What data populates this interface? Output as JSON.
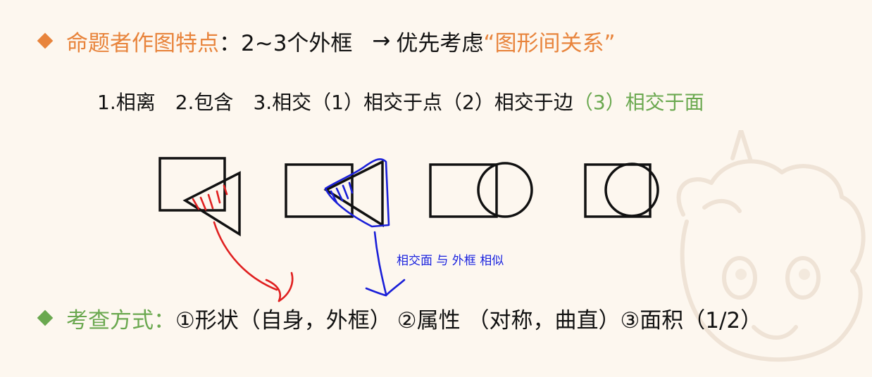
{
  "heading": {
    "label": "命题者作图特点",
    "colon": "：",
    "text": "2~3个外框",
    "arrow": "→",
    "priority": "优先考虑",
    "quote": "“图形间关系”"
  },
  "relations": {
    "r1": "1.相离",
    "r2": "2.包含",
    "r3": "3.相交",
    "s1": "（1）相交于点",
    "s2": "（2）相交于边",
    "s3": "（3）相交于面"
  },
  "annotation": "相交面 与 外框 相似",
  "exam": {
    "label": "考查方式",
    "colon": "：",
    "i1": "①形状（自身，外框）",
    "i2": "②属性 （对称，曲直）",
    "i3": "③面积（1/2）"
  },
  "colors": {
    "orange": "#e8843c",
    "green": "#6aa84f",
    "ink": "#111111",
    "red_pen": "#e02020",
    "blue_pen": "#1a1fd8",
    "background": "#fdf7ef"
  }
}
